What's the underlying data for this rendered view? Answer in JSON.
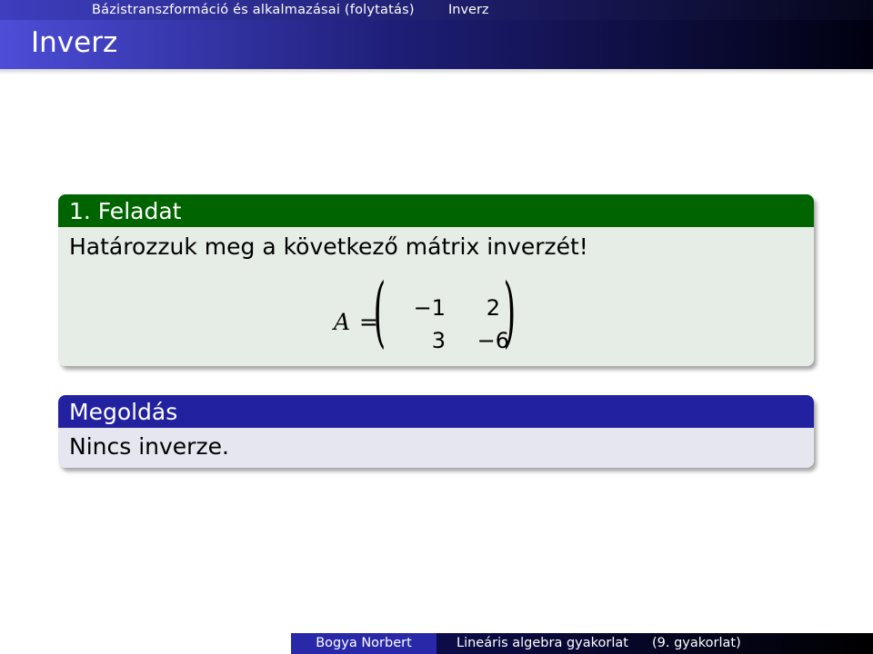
{
  "header": {
    "section": "Bázistranszformáció és alkalmazásai (folytatás)",
    "subsection": "Inverz"
  },
  "frame": {
    "title": "Inverz"
  },
  "exercise": {
    "title": "1. Feladat",
    "text": "Határozzuk meg a következő mátrix inverzét!",
    "matrix_label": "A",
    "equals": "=",
    "matrix": [
      [
        "−1",
        "2"
      ],
      [
        "3",
        "−6"
      ]
    ]
  },
  "solution": {
    "title": "Megoldás",
    "text": "Nincs inverze."
  },
  "footer": {
    "author": "Bogya Norbert",
    "course": "Lineáris algebra gyakorlat",
    "session": "(9. gyakorlat)"
  },
  "colors": {
    "header_blue": "#3e3ebf",
    "exercise_green": "#006400",
    "solution_blue": "#2222a0"
  }
}
